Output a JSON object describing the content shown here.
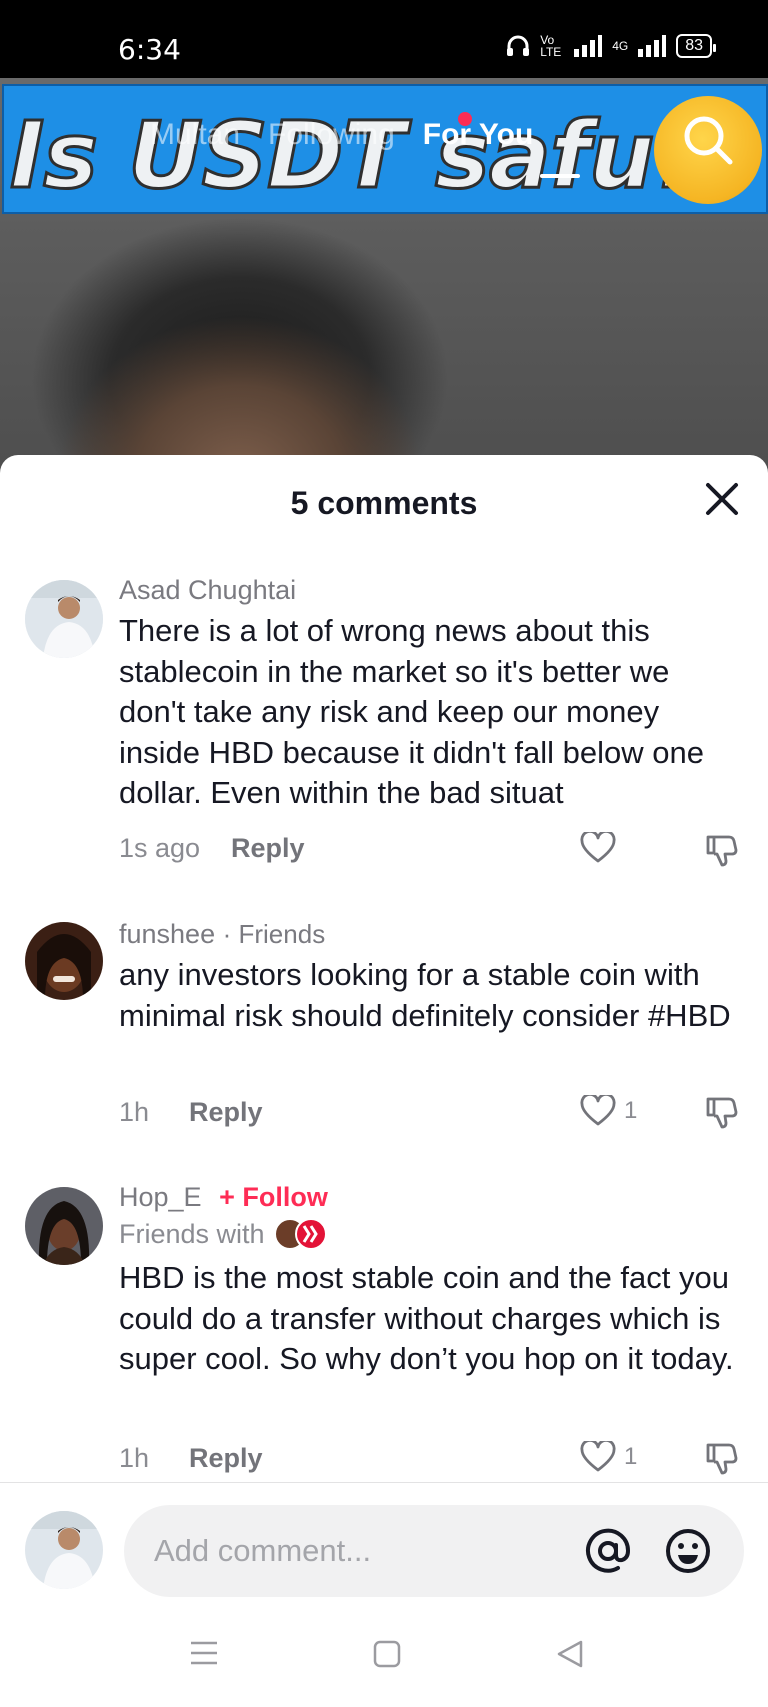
{
  "status_bar": {
    "time": "6:34",
    "network_label": "Vo LTE",
    "signal_label": "4G",
    "battery": "83"
  },
  "video": {
    "banner_text": "Is USDT safu?",
    "tabs": [
      {
        "label": "Multan"
      },
      {
        "label": "Following"
      },
      {
        "label": "For You"
      }
    ]
  },
  "comments_sheet": {
    "title": "5 comments",
    "comments": [
      {
        "username": "Asad Chughtai",
        "text": "There is a lot of wrong news about this stablecoin in the market so it's better we don't take any risk and keep our money inside HBD because it didn't fall below one dollar. Even within the bad situat",
        "time": "1s ago",
        "reply_label": "Reply",
        "likes": ""
      },
      {
        "username": "funshee",
        "relation": "· Friends",
        "text": "any investors looking for a stable coin with minimal risk should definitely consider #HBD",
        "time": "1h",
        "reply_label": "Reply",
        "likes": "1"
      },
      {
        "username": "Hop_E",
        "follow_label": "+ Follow",
        "friends_with_label": "Friends with",
        "text": "HBD is the most stable coin and the fact you could do a transfer without charges which is super cool. So why don’t you hop on it today.",
        "time": "1h",
        "reply_label": "Reply",
        "likes": "1"
      }
    ],
    "input": {
      "placeholder": "Add comment..."
    }
  },
  "colors": {
    "accent": "#fe2c55",
    "banner_blue": "#1e8fe6",
    "text_primary": "#161823",
    "text_secondary": "#8a8b91"
  }
}
